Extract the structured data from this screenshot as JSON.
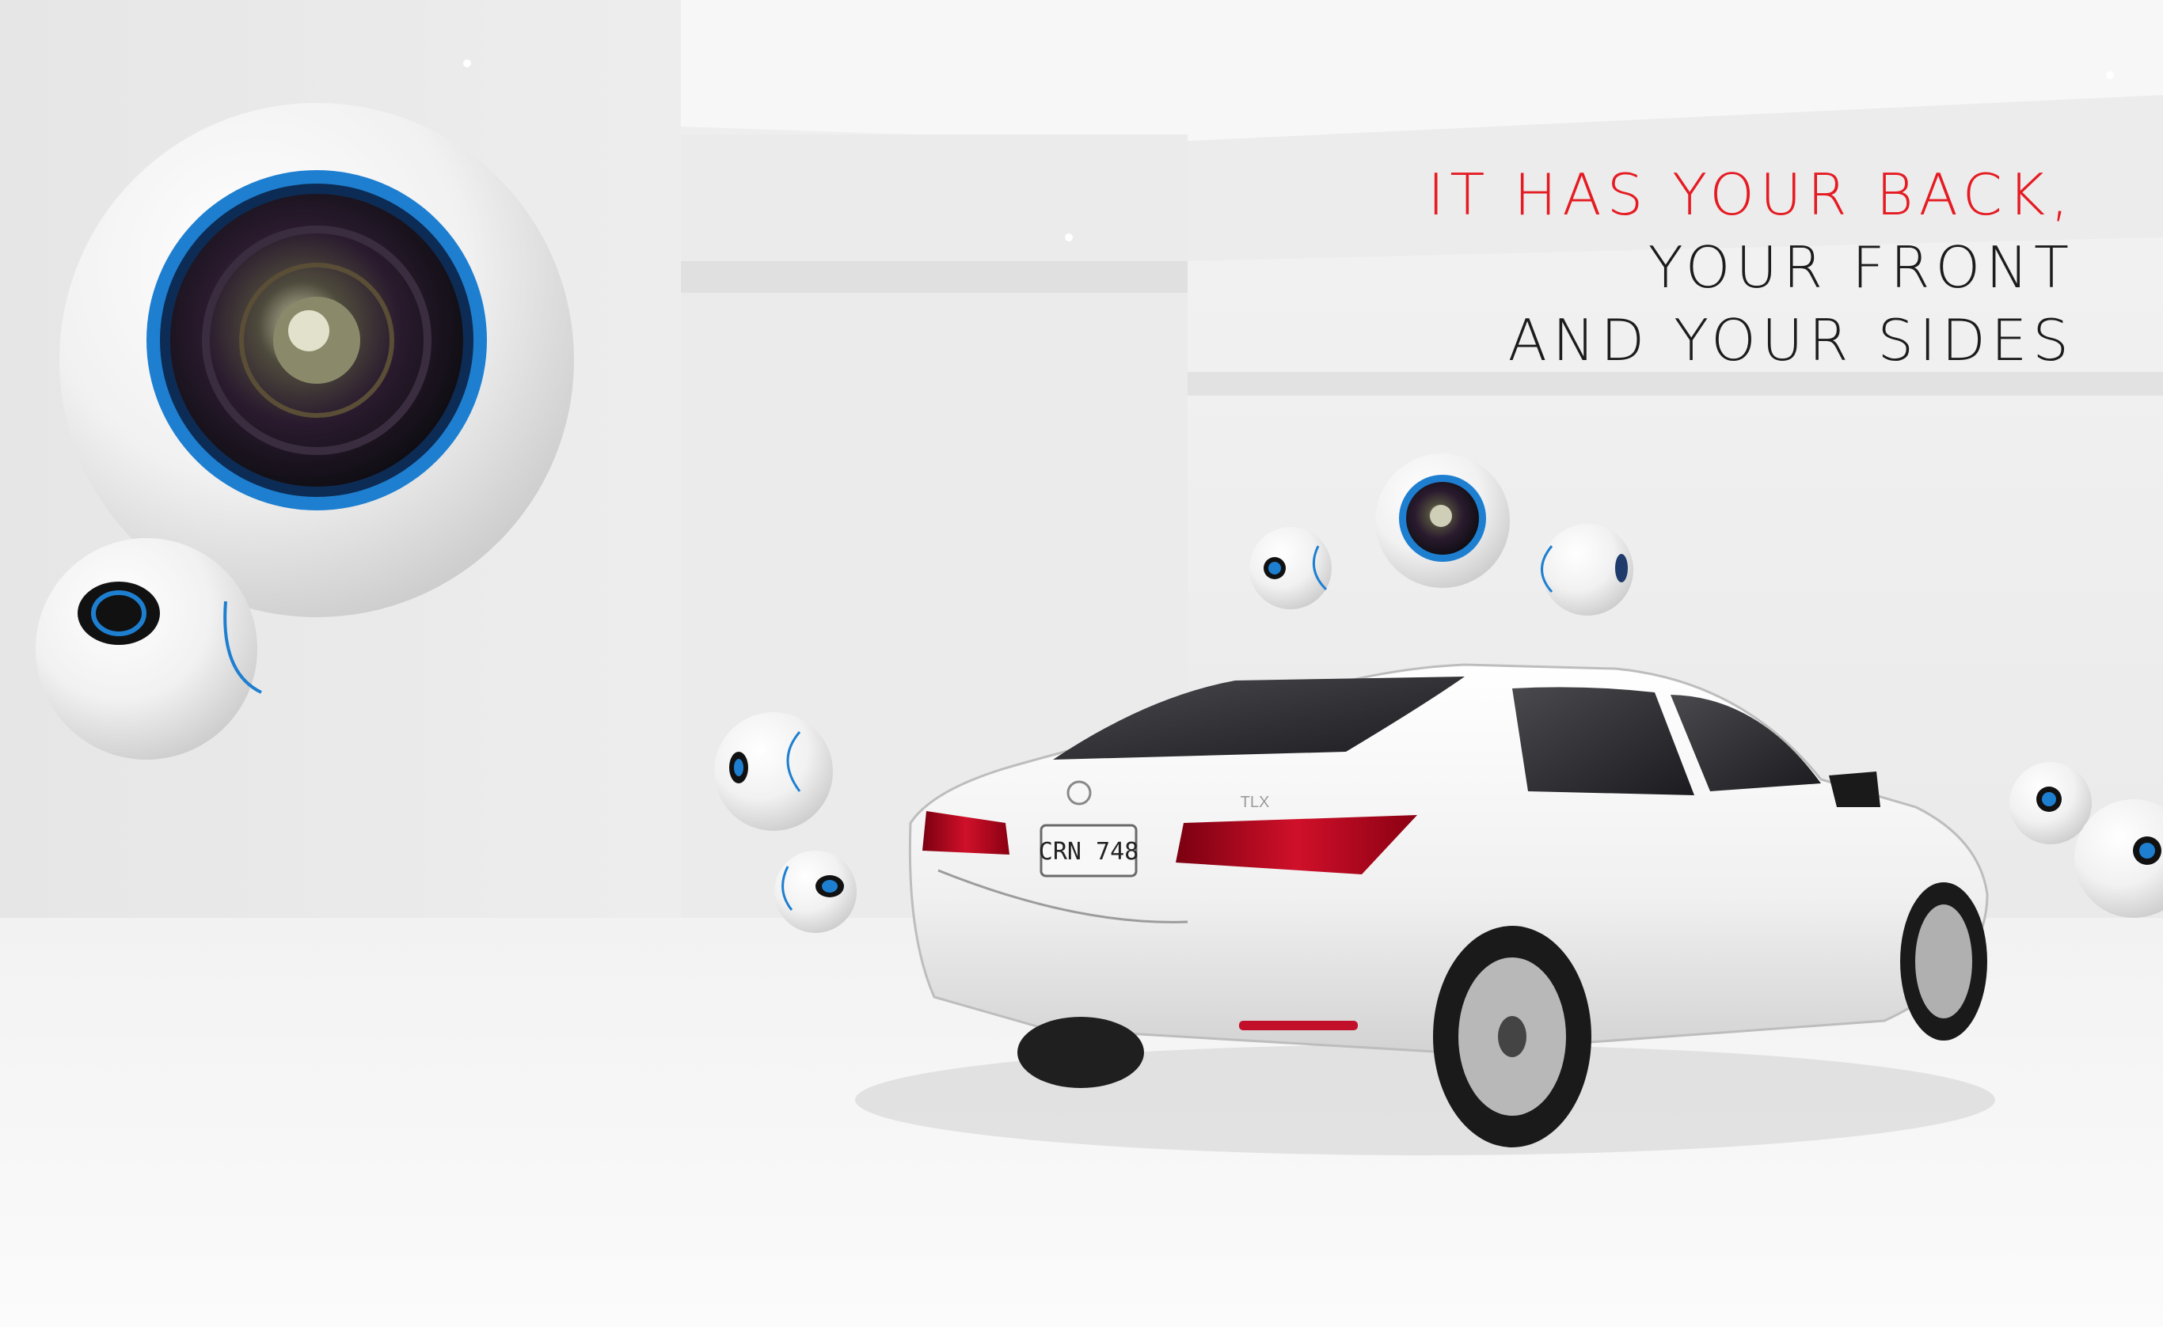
{
  "headline": {
    "line1": "IT HAS YOUR BACK,",
    "line2": "YOUR FRONT",
    "line3": "AND YOUR SIDES"
  },
  "car": {
    "license_plate": "CRN 748",
    "trunk_badge": "TLX"
  },
  "colors": {
    "accent_red": "#e51b22",
    "camera_blue": "#1e7fd0",
    "text_dark": "#1c1c1c",
    "background": "#eeeeee"
  },
  "icons": [
    "camera-lens-icon",
    "car-image"
  ]
}
